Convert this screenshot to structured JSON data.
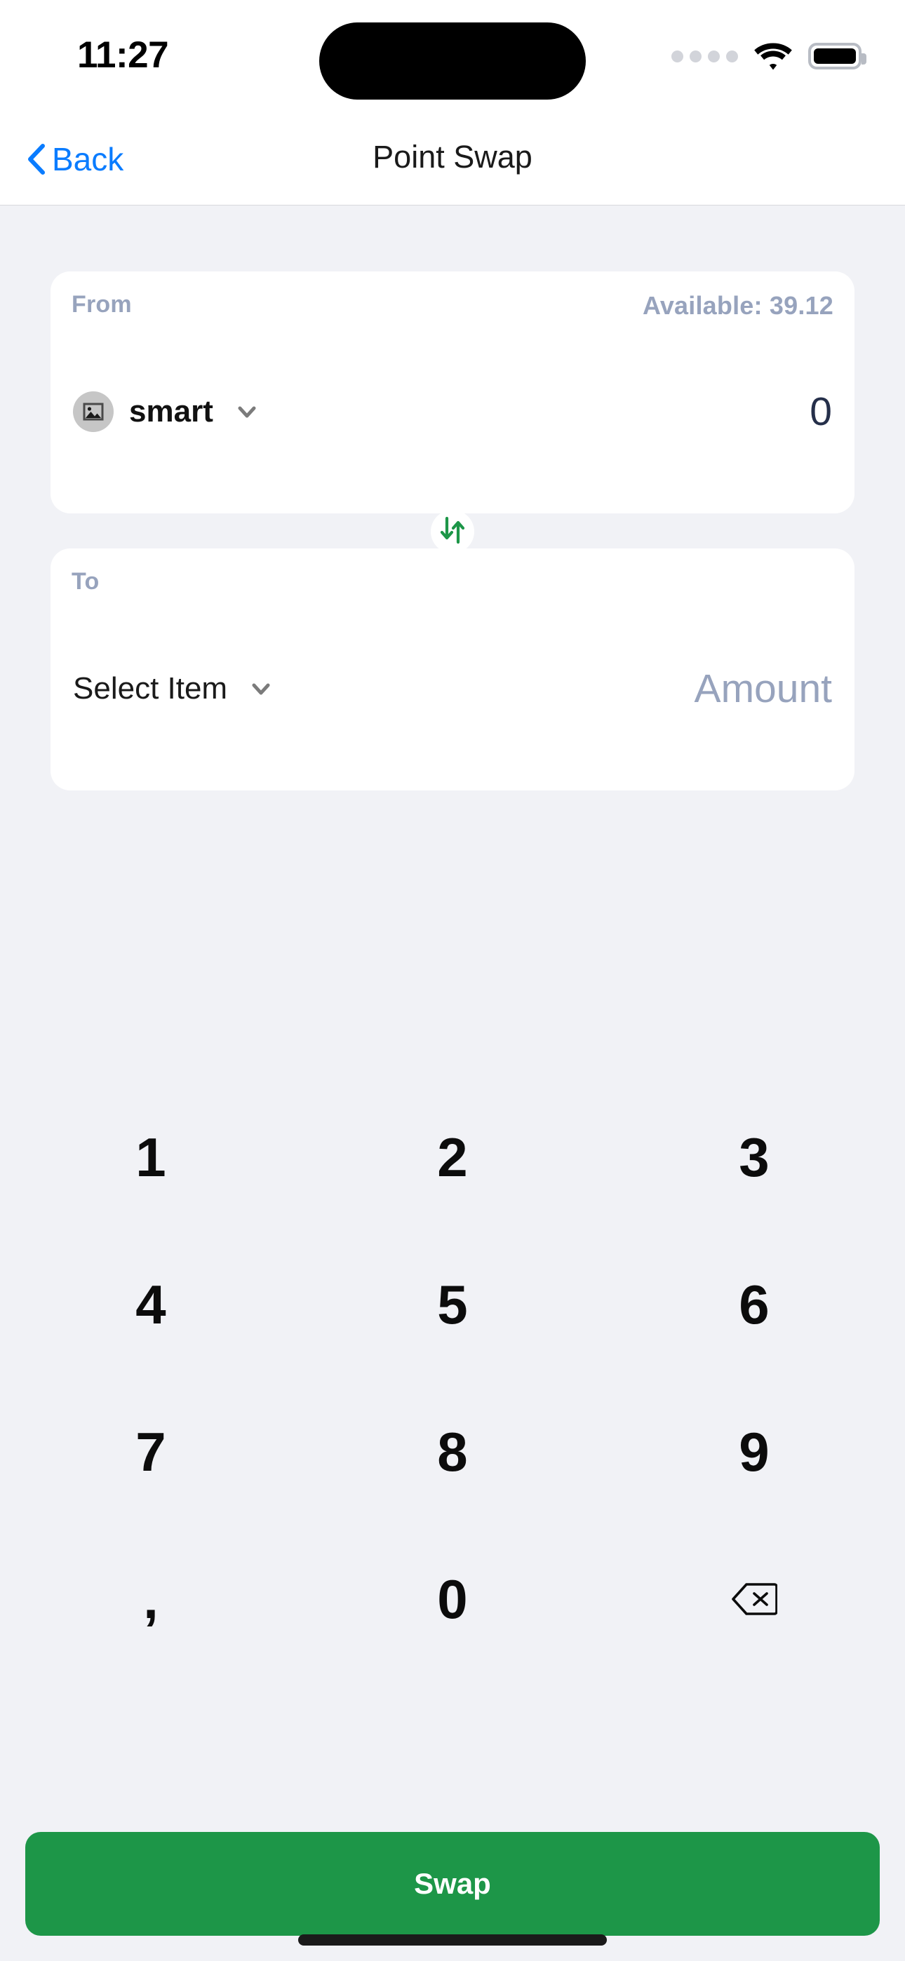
{
  "status_bar": {
    "time": "11:27",
    "cellular_icon": "cellular-dots-icon",
    "wifi_icon": "wifi-icon",
    "battery_icon": "battery-full-icon"
  },
  "nav": {
    "back_label": "Back",
    "back_icon": "chevron-left-icon",
    "title": "Point Swap"
  },
  "from_card": {
    "label": "From",
    "available": "Available: 39.12",
    "token_name": "smart",
    "token_avatar_icon": "image-placeholder-icon",
    "dropdown_icon": "chevron-down-icon",
    "amount": "0"
  },
  "swap_toggle": {
    "icon": "swap-vertical-arrows-icon"
  },
  "to_card": {
    "label": "To",
    "token_name": "Select Item",
    "dropdown_icon": "chevron-down-icon",
    "amount_placeholder": "Amount"
  },
  "keypad": {
    "keys": [
      {
        "label": "1",
        "name": "key-1"
      },
      {
        "label": "2",
        "name": "key-2"
      },
      {
        "label": "3",
        "name": "key-3"
      },
      {
        "label": "4",
        "name": "key-4"
      },
      {
        "label": "5",
        "name": "key-5"
      },
      {
        "label": "6",
        "name": "key-6"
      },
      {
        "label": "7",
        "name": "key-7"
      },
      {
        "label": "8",
        "name": "key-8"
      },
      {
        "label": "9",
        "name": "key-9"
      },
      {
        "label": ",",
        "name": "key-comma"
      },
      {
        "label": "0",
        "name": "key-0"
      },
      {
        "label": "",
        "name": "key-backspace"
      }
    ],
    "backspace_icon": "backspace-delete-icon"
  },
  "primary_action": {
    "label": "Swap"
  },
  "colors": {
    "background": "#f1f2f6",
    "card": "#ffffff",
    "accent_green": "#1d9648",
    "link_blue": "#0a7cff",
    "muted_slate": "#97a3bd",
    "amount_navy": "#252f4a"
  }
}
